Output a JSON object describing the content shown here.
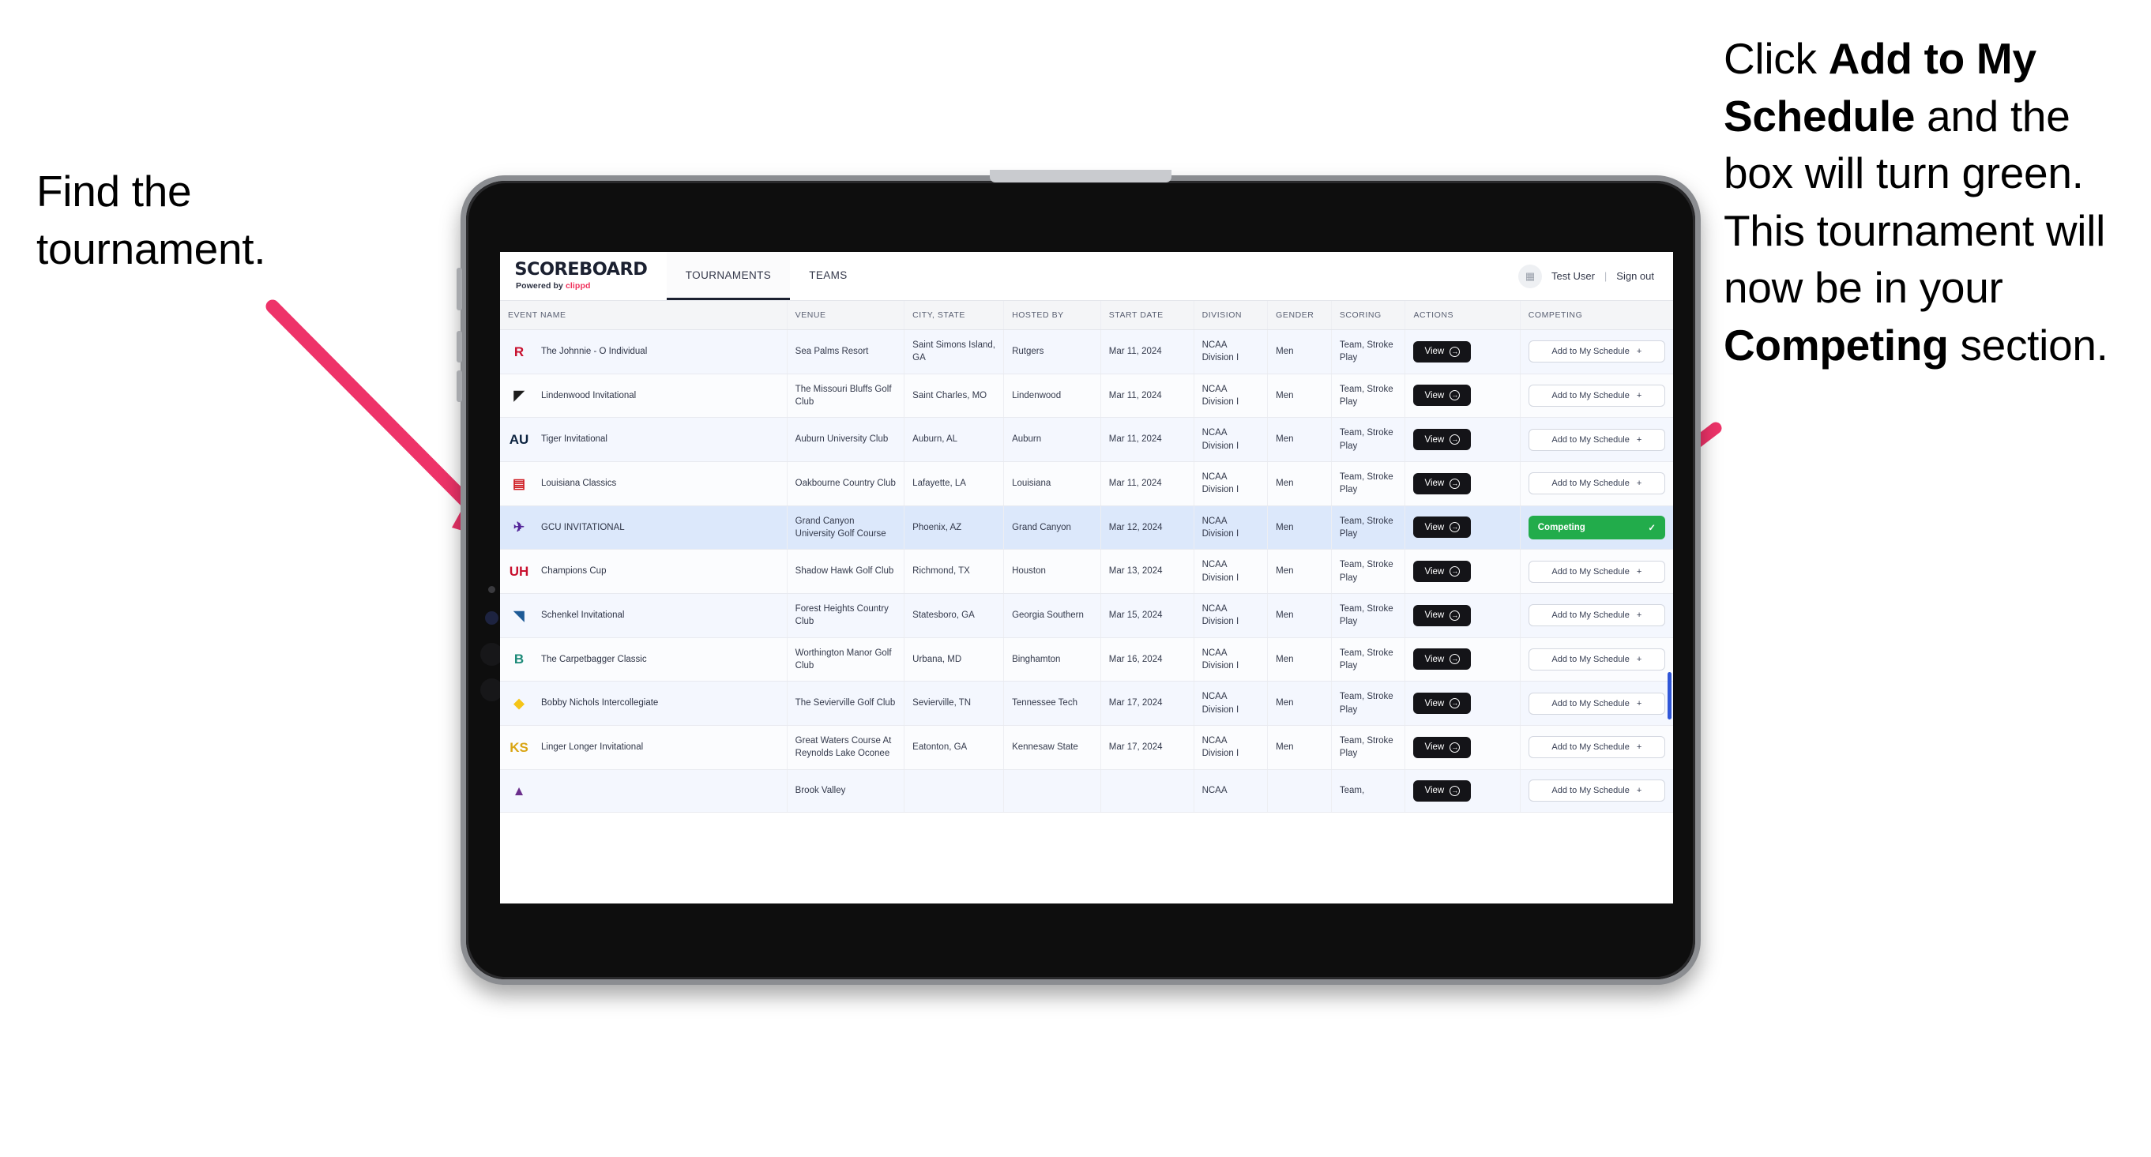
{
  "annotations": {
    "left": "Find the tournament.",
    "right_parts": [
      {
        "text": "Click ",
        "bold": false
      },
      {
        "text": "Add to My Schedule",
        "bold": true
      },
      {
        "text": " and the box will turn green. This tournament will now be in your ",
        "bold": false
      },
      {
        "text": "Competing",
        "bold": true
      },
      {
        "text": " section.",
        "bold": false
      }
    ],
    "arrow_color": "#ee3369"
  },
  "app": {
    "brand": {
      "title": "SCOREBOARD",
      "subtitle_prefix": "Powered by ",
      "subtitle_brand": "clippd"
    },
    "tabs": [
      {
        "label": "TOURNAMENTS",
        "active": true
      },
      {
        "label": "TEAMS",
        "active": false
      }
    ],
    "header_right": {
      "avatar_icon": "user-avatar-icon",
      "user_name": "Test User",
      "separator": "|",
      "sign_out": "Sign out"
    }
  },
  "table": {
    "columns": [
      "EVENT NAME",
      "VENUE",
      "CITY, STATE",
      "HOSTED BY",
      "START DATE",
      "DIVISION",
      "GENDER",
      "SCORING",
      "ACTIONS",
      "COMPETING"
    ],
    "view_label": "View",
    "add_label": "Add to My Schedule",
    "add_icon": "+",
    "competing_label": "Competing",
    "competing_icon": "check-icon",
    "rows": [
      {
        "logo": {
          "text": "R",
          "color": "#c8102e",
          "bg": "transparent"
        },
        "event": "The Johnnie - O Individual",
        "venue": "Sea Palms Resort",
        "city": "Saint Simons Island, GA",
        "host": "Rutgers",
        "date": "Mar 11, 2024",
        "division": "NCAA Division I",
        "gender": "Men",
        "scoring": "Team, Stroke Play",
        "competing": false
      },
      {
        "logo": {
          "text": "◤",
          "color": "#1c1c1c",
          "bg": "transparent"
        },
        "event": "Lindenwood Invitational",
        "venue": "The Missouri Bluffs Golf Club",
        "city": "Saint Charles, MO",
        "host": "Lindenwood",
        "date": "Mar 11, 2024",
        "division": "NCAA Division I",
        "gender": "Men",
        "scoring": "Team, Stroke Play",
        "competing": false
      },
      {
        "logo": {
          "text": "AU",
          "color": "#0c2340",
          "bg": "transparent"
        },
        "event": "Tiger Invitational",
        "venue": "Auburn University Club",
        "city": "Auburn, AL",
        "host": "Auburn",
        "date": "Mar 11, 2024",
        "division": "NCAA Division I",
        "gender": "Men",
        "scoring": "Team, Stroke Play",
        "competing": false
      },
      {
        "logo": {
          "text": "▤",
          "color": "#ce181e",
          "bg": "transparent"
        },
        "event": "Louisiana Classics",
        "venue": "Oakbourne Country Club",
        "city": "Lafayette, LA",
        "host": "Louisiana",
        "date": "Mar 11, 2024",
        "division": "NCAA Division I",
        "gender": "Men",
        "scoring": "Team, Stroke Play",
        "competing": false
      },
      {
        "logo": {
          "text": "✈",
          "color": "#522398",
          "bg": "transparent"
        },
        "event": "GCU INVITATIONAL",
        "venue": "Grand Canyon University Golf Course",
        "city": "Phoenix, AZ",
        "host": "Grand Canyon",
        "date": "Mar 12, 2024",
        "division": "NCAA Division I",
        "gender": "Men",
        "scoring": "Team, Stroke Play",
        "competing": true
      },
      {
        "logo": {
          "text": "UH",
          "color": "#c8102e",
          "bg": "transparent"
        },
        "event": "Champions Cup",
        "venue": "Shadow Hawk Golf Club",
        "city": "Richmond, TX",
        "host": "Houston",
        "date": "Mar 13, 2024",
        "division": "NCAA Division I",
        "gender": "Men",
        "scoring": "Team, Stroke Play",
        "competing": false
      },
      {
        "logo": {
          "text": "◥",
          "color": "#1d5a96",
          "bg": "transparent"
        },
        "event": "Schenkel Invitational",
        "venue": "Forest Heights Country Club",
        "city": "Statesboro, GA",
        "host": "Georgia Southern",
        "date": "Mar 15, 2024",
        "division": "NCAA Division I",
        "gender": "Men",
        "scoring": "Team, Stroke Play",
        "competing": false
      },
      {
        "logo": {
          "text": "B",
          "color": "#1c8a78",
          "bg": "transparent"
        },
        "event": "The Carpetbagger Classic",
        "venue": "Worthington Manor Golf Club",
        "city": "Urbana, MD",
        "host": "Binghamton",
        "date": "Mar 16, 2024",
        "division": "NCAA Division I",
        "gender": "Men",
        "scoring": "Team, Stroke Play",
        "competing": false
      },
      {
        "logo": {
          "text": "◆",
          "color": "#f5c518",
          "bg": "transparent"
        },
        "event": "Bobby Nichols Intercollegiate",
        "venue": "The Sevierville Golf Club",
        "city": "Sevierville, TN",
        "host": "Tennessee Tech",
        "date": "Mar 17, 2024",
        "division": "NCAA Division I",
        "gender": "Men",
        "scoring": "Team, Stroke Play",
        "competing": false
      },
      {
        "logo": {
          "text": "KS",
          "color": "#d9a514",
          "bg": "transparent"
        },
        "event": "Linger Longer Invitational",
        "venue": "Great Waters Course At Reynolds Lake Oconee",
        "city": "Eatonton, GA",
        "host": "Kennesaw State",
        "date": "Mar 17, 2024",
        "division": "NCAA Division I",
        "gender": "Men",
        "scoring": "Team, Stroke Play",
        "competing": false
      },
      {
        "logo": {
          "text": "▲",
          "color": "#6b2f8c",
          "bg": "transparent"
        },
        "event": "",
        "venue": "Brook Valley",
        "city": "",
        "host": "",
        "date": "",
        "division": "NCAA",
        "gender": "",
        "scoring": "Team,",
        "competing": false,
        "clipped": true
      }
    ]
  }
}
